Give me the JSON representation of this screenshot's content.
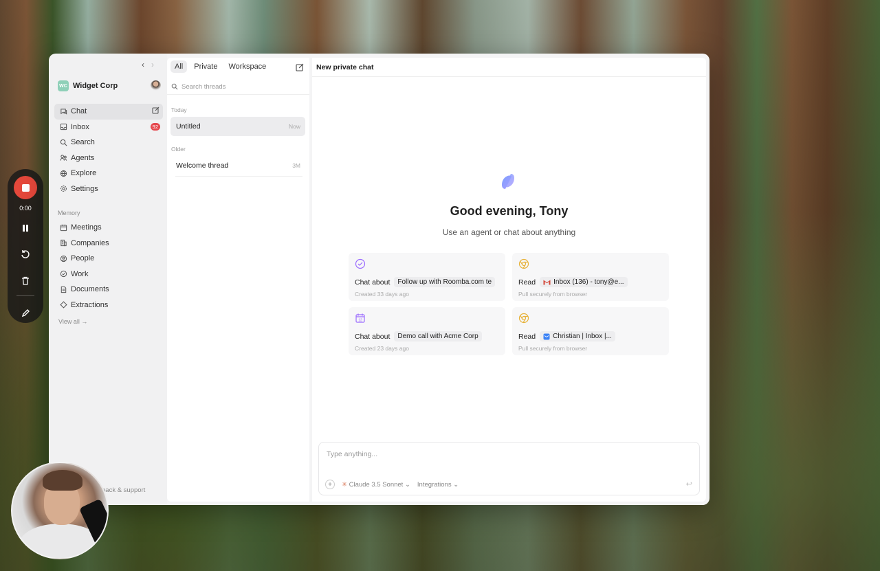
{
  "recorder": {
    "time": "0:00"
  },
  "sidebar": {
    "workspace_initials": "WC",
    "workspace_name": "Widget Corp",
    "nav": [
      {
        "label": "Chat",
        "icon": "chat-icon"
      },
      {
        "label": "Inbox",
        "icon": "inbox-icon",
        "badge": "92"
      },
      {
        "label": "Search",
        "icon": "search-icon"
      },
      {
        "label": "Agents",
        "icon": "agents-icon"
      },
      {
        "label": "Explore",
        "icon": "globe-icon"
      },
      {
        "label": "Settings",
        "icon": "gear-icon"
      }
    ],
    "memory_label": "Memory",
    "memory": [
      {
        "label": "Meetings",
        "icon": "calendar-icon"
      },
      {
        "label": "Companies",
        "icon": "building-icon"
      },
      {
        "label": "People",
        "icon": "person-icon"
      },
      {
        "label": "Work",
        "icon": "check-circle-icon"
      },
      {
        "label": "Documents",
        "icon": "document-icon"
      },
      {
        "label": "Extractions",
        "icon": "diamond-icon"
      }
    ],
    "view_all": "View all",
    "feedback": "back & support"
  },
  "threads": {
    "tabs": [
      "All",
      "Private",
      "Workspace"
    ],
    "search_placeholder": "Search threads",
    "groups": [
      {
        "label": "Today",
        "items": [
          {
            "title": "Untitled",
            "time": "Now"
          }
        ]
      },
      {
        "label": "Older",
        "items": [
          {
            "title": "Welcome thread",
            "time": "3M"
          }
        ]
      }
    ]
  },
  "chat": {
    "header": "New private chat",
    "greeting": "Good evening, Tony",
    "subtitle": "Use an agent or chat about anything",
    "cards": [
      {
        "verb": "Chat about",
        "pill": "Follow up with Roomba.com te",
        "meta": "Created 33 days ago",
        "icon": "check-circle-icon"
      },
      {
        "verb": "Read",
        "pill": "Inbox (136) - tony@e...",
        "meta": "Pull securely from browser",
        "icon": "chrome-icon",
        "pill_icon": "gmail-icon"
      },
      {
        "verb": "Chat about",
        "pill": "Demo call with Acme Corp",
        "meta": "Created 23 days ago",
        "icon": "calendar-icon"
      },
      {
        "verb": "Read",
        "pill": "Christian | Inbox |...",
        "meta": "Pull securely from browser",
        "icon": "chrome-icon",
        "pill_icon": "mail-app-icon"
      }
    ],
    "composer": {
      "placeholder": "Type anything...",
      "model": "Claude 3.5 Sonnet",
      "integrations": "Integrations"
    }
  },
  "colors": {
    "accent": "#7c5cff",
    "badge": "#e5484d",
    "record": "#e5483b"
  }
}
